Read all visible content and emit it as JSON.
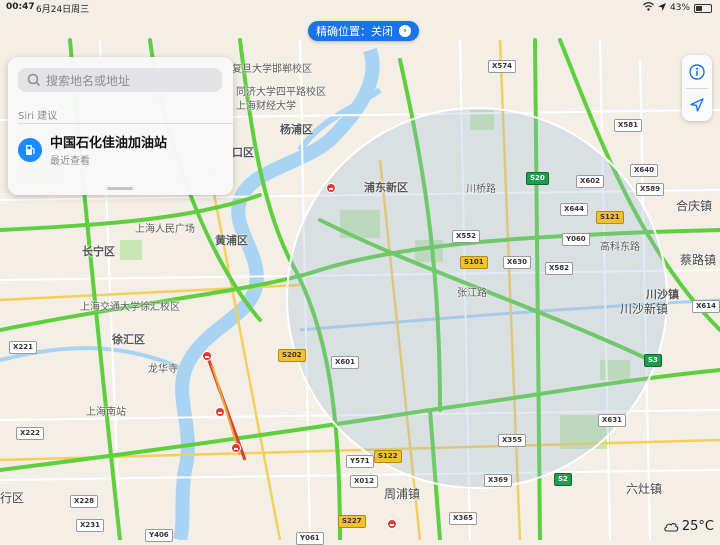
{
  "status": {
    "time": "00:47",
    "date": "6月24日周三",
    "battery": "43%"
  },
  "precise_location": {
    "label": "精确位置：关闭"
  },
  "sheet": {
    "search_placeholder": "搜索地名或地址",
    "siri_header": "Siri 建议",
    "suggestion_title": "中国石化佳油加油站",
    "suggestion_subtitle": "最近查看"
  },
  "weather": {
    "temp": "25°C"
  },
  "map_labels": {
    "pudong": "浦东新区",
    "huangpu": "黄浦区",
    "yangpu": "杨浦区",
    "changning": "长宁区",
    "xuhui": "徐汇区",
    "kou": "口区",
    "chuansha": "川沙镇",
    "chuansha_xin": "川沙新镇",
    "heqing": "合庆镇",
    "caolu": "蔡路镇",
    "zhoupu": "周浦镇",
    "liuzao": "六灶镇",
    "hangtou": "行区",
    "shanghai_south": "上海南站",
    "peoples_sq": "上海人民广场",
    "sjtu": "上海交通大学徐汇校区",
    "fudan": "复旦大学邯郸校区",
    "tongji": "同济大学四平路校区",
    "shangwu": "上海财经大学",
    "longhua": "龙华寺",
    "gaoke": "高科东路",
    "chuanqiao": "川桥路",
    "zhangjiang": "张江路"
  },
  "road_tags": [
    "X574",
    "X581",
    "S20",
    "X602",
    "X640",
    "X589",
    "X644",
    "S121",
    "Y060",
    "X552",
    "X630",
    "X582",
    "S101",
    "X614",
    "X221",
    "S202",
    "X601",
    "S3",
    "X631",
    "X222",
    "X355",
    "Y571",
    "X012",
    "S122",
    "X369",
    "X228",
    "S2",
    "X231",
    "S227",
    "X365",
    "Y406",
    "Y061"
  ],
  "colors": {
    "accent": "#1a73e8",
    "water": "#a9d3f2",
    "green": "#c9e6b5",
    "highway": "#5fcf3f"
  }
}
